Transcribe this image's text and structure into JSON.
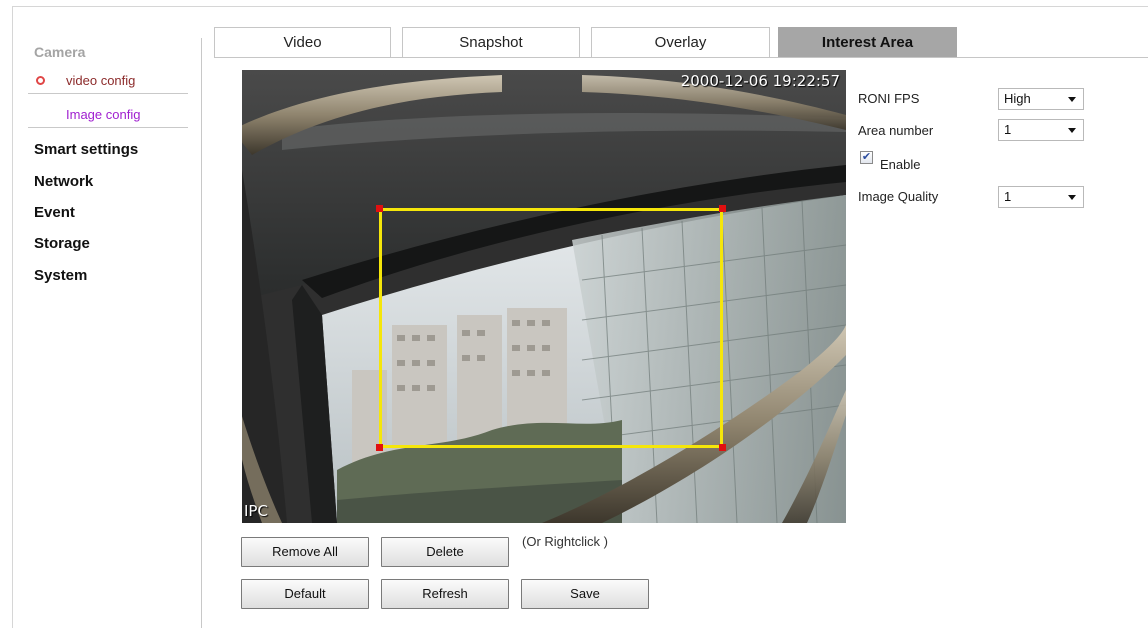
{
  "sidebar": {
    "title": "Camera",
    "sub_items": [
      {
        "label": "video config",
        "active": true
      },
      {
        "label": "Image config",
        "active": false
      }
    ],
    "menu": [
      "Smart settings",
      "Network",
      "Event",
      "Storage",
      "System"
    ]
  },
  "tabs": [
    {
      "label": "Video",
      "active": false
    },
    {
      "label": "Snapshot",
      "active": false
    },
    {
      "label": "Overlay",
      "active": false
    },
    {
      "label": "Interest Area",
      "active": true
    }
  ],
  "video": {
    "timestamp": "2000-12-06 19:22:57",
    "channel_label": "IPC",
    "roi_color": "#f5e60a",
    "handle_color": "#e01010"
  },
  "buttons": {
    "remove_all": "Remove All",
    "delete": "Delete",
    "hint": "(Or Rightclick )",
    "default": "Default",
    "refresh": "Refresh",
    "save": "Save"
  },
  "settings": {
    "roni_fps_label": "RONI FPS",
    "roni_fps_value": "High",
    "area_number_label": "Area number",
    "area_number_value": "1",
    "enable_label": "Enable",
    "enable_checked": true,
    "image_quality_label": "Image Quality",
    "image_quality_value": "1"
  },
  "colors": {
    "active_tab_bg": "#a6a6a6",
    "sub_item_active": "#8c2b2b",
    "sub_item_other": "#a020d0",
    "ring": "#e04646"
  }
}
